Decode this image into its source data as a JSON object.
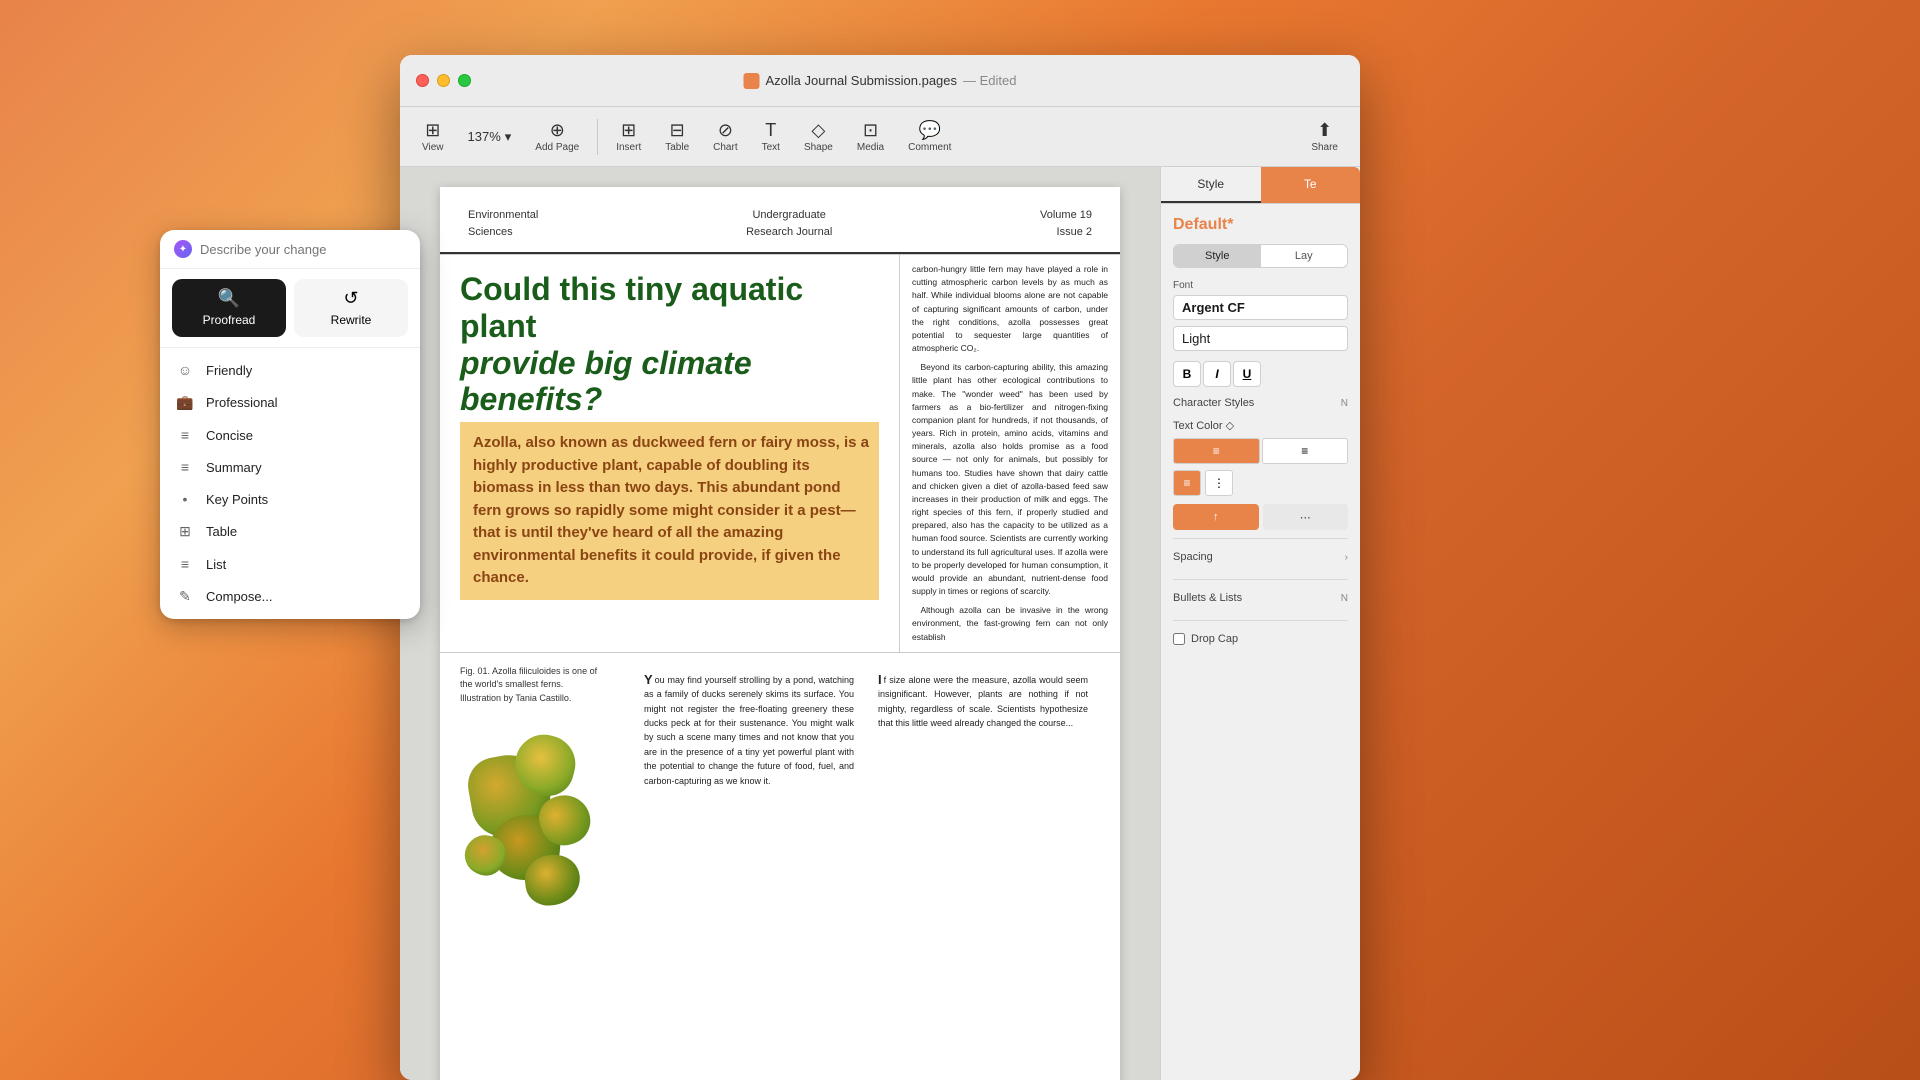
{
  "window": {
    "title": "Azolla Journal Submission.pages",
    "edited_label": "— Edited"
  },
  "toolbar": {
    "view_label": "View",
    "zoom_label": "137%",
    "add_page_label": "Add Page",
    "insert_label": "Insert",
    "table_label": "Table",
    "chart_label": "Chart",
    "text_label": "Text",
    "shape_label": "Shape",
    "media_label": "Media",
    "comment_label": "Comment",
    "share_label": "Share"
  },
  "journal_header": {
    "left_line1": "Environmental",
    "left_line2": "Sciences",
    "center_line1": "Undergraduate",
    "center_line2": "Research Journal",
    "right_line1": "Volume 19",
    "right_line2": "Issue 2"
  },
  "article": {
    "title_line1": "Could this tiny aquatic plant",
    "title_line2": "provide big climate benefits?",
    "highlighted_text": "Azolla, also known as duckweed fern or fairy moss, is a highly productive plant, capable of doubling its biomass in less than two days. This abundant pond fern grows so rapidly some might consider it a pest—that is until they've heard of all the amazing environmental benefits it could provide, if given the chance.",
    "side_text_short": "carbon-hungry little fern may have played a role in cutting atmospheric carbon levels by as much as half. While individual blooms alone are not capable of capturing significant amounts of carbon, under the right conditions, azolla possesses great potential to sequester large quantities of atmospheric CO₂.\n\nBeyond its carbon-capturing ability, this amazing little plant has other ecological contributions to make. The 'wonder weed' has been used by farmers as a bio-fertilizer and nitrogen-fixing companion plant for hundreds, if not thousands, of years. Rich in protein, amino acids, vitamins and minerals, azolla also holds promise as a food source — not only for animals, but possibly for humans too. Studies have shown that dairy cattle and chicken given a diet of azolla-based feed saw increases in their production of milk and eggs. The right species of this fern, if properly studied and prepared, also has the capacity to be utilized as a human food source. Scientists are currently working to understand its full agricultural uses. If azolla were to be properly developed for human consumption, it would provide an abundant, nutrient-dense food supply in times or regions of scarcity.\n\nAlthough azolla can be invasive in the wrong environment, the fast-growing fern can not only establish",
    "figure_caption": "Fig. 01. Azolla filiculoides is one of the world's smallest ferns. Illustration by Tania Castillo.",
    "body_col1": "You may find yourself strolling by a pond, watching as a family of ducks serenely skims its surface. You might not register the free-floating greenery these ducks peck at for their sustenance. You might walk by such a scene many times and not know that you are in the presence of a tiny yet powerful plant with the potential to change the future of food, fuel, and carbon-capturing as we know it.",
    "body_col2": "If size alone were the measure, azolla would seem insignificant. However, plants are nothing if not mighty, regardless of scale. Scientists hypothesize that this little weed already changed the course..."
  },
  "right_panel": {
    "style_tab": "Style",
    "text_tab": "Te",
    "default_label": "Default",
    "default_asterisk": "*",
    "style_subtab": "Style",
    "layout_subtab": "Lay",
    "font_section": "Font",
    "font_name": "Argent CF",
    "font_style": "Light",
    "bold_label": "B",
    "italic_label": "I",
    "underline_label": "U",
    "char_styles_label": "Character Styles",
    "text_color_label": "Text Color ◇",
    "spacing_label": "Spacing",
    "bullets_label": "Bullets & Lists",
    "drop_cap_label": "Drop Cap"
  },
  "ai_panel": {
    "search_placeholder": "Describe your change",
    "proofread_label": "Proofread",
    "rewrite_label": "Rewrite",
    "menu_items": [
      {
        "icon": "☺",
        "label": "Friendly"
      },
      {
        "icon": "💼",
        "label": "Professional"
      },
      {
        "icon": "≡",
        "label": "Concise"
      },
      {
        "icon": "≡",
        "label": "Summary"
      },
      {
        "icon": "•",
        "label": "Key Points"
      },
      {
        "icon": "⊞",
        "label": "Table"
      },
      {
        "icon": "≡",
        "label": "List"
      },
      {
        "icon": "✎",
        "label": "Compose..."
      }
    ]
  }
}
